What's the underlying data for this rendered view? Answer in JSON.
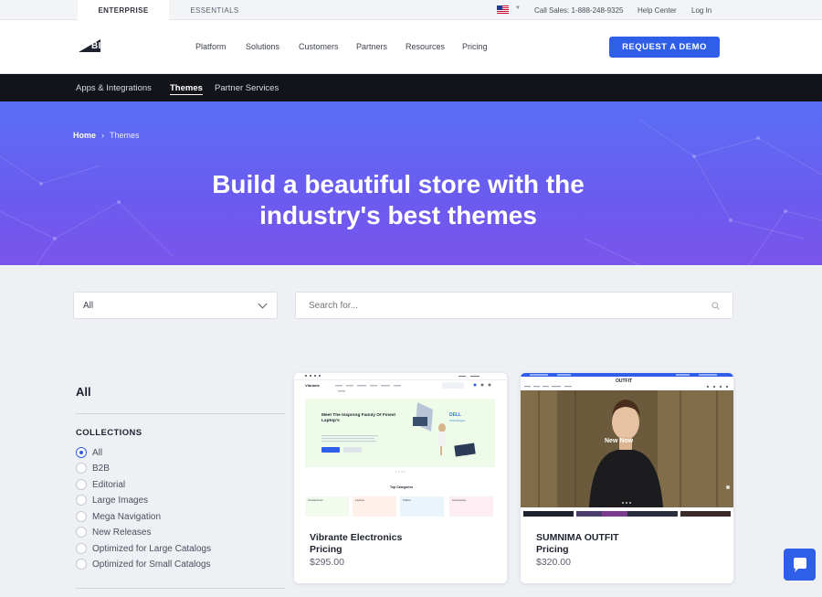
{
  "utility": {
    "tabs": [
      "ENTERPRISE",
      "ESSENTIALS"
    ],
    "sales": "Call Sales: 1-888-248-9325",
    "help": "Help Center",
    "login": "Log In"
  },
  "header": {
    "logo_text": "BIGCOMMERCE",
    "nav": [
      "Platform",
      "Solutions",
      "Customers",
      "Partners",
      "Resources",
      "Pricing"
    ],
    "cta": "REQUEST A DEMO"
  },
  "subnav": {
    "items": [
      "Apps & Integrations",
      "Themes",
      "Partner Services"
    ],
    "active": "Themes"
  },
  "hero": {
    "breadcrumb": {
      "home": "Home",
      "separator": "›",
      "current": "Themes"
    },
    "title_line1": "Build a beautiful store with the",
    "title_line2": "industry's best themes"
  },
  "filters": {
    "select_value": "All",
    "search_placeholder": "Search for..."
  },
  "sidebar": {
    "title": "All",
    "collections_heading": "COLLECTIONS",
    "options": [
      "All",
      "B2B",
      "Editorial",
      "Large Images",
      "Mega Navigation",
      "New Releases",
      "Optimized for Large Catalogs",
      "Optimized for Small Catalogs"
    ],
    "selected": "All"
  },
  "cards": [
    {
      "name": "Vibrante Electronics",
      "price_label": "Pricing",
      "price": "$295.00",
      "preview": {
        "brand": "Vibrante",
        "headline": "Meet The Inspiring Family Of Finest Laptop's",
        "partner": "DELL Technologies",
        "section": "Top Categories",
        "categories": [
          "Smartphones",
          "Laptops",
          "Tablets",
          "Accessories"
        ]
      }
    },
    {
      "name": "SUMNIMA OUTFIT",
      "price_label": "Pricing",
      "price": "$320.00",
      "preview": {
        "brand": "OUTFIT",
        "hero_text": "New Now"
      }
    }
  ],
  "colors": {
    "accent": "#2f5fe8",
    "hero_start": "#5a6ff5",
    "hero_end": "#7a55ec",
    "subnav_bg": "#121419"
  },
  "icons": {
    "chat": "chat-bubble-icon",
    "search": "search-icon",
    "chevron": "chevron-down-icon",
    "flag": "us-flag-icon"
  }
}
